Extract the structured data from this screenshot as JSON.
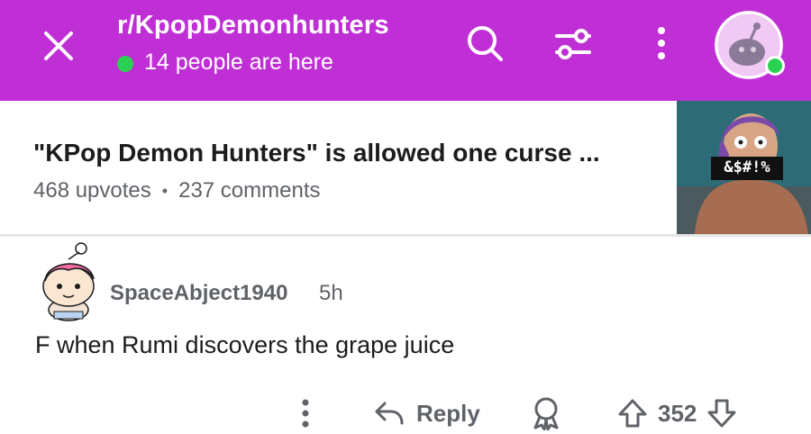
{
  "header": {
    "community": "r/KpopDemonhunters",
    "online_text": "14 people are here",
    "accent_color": "#c02fd6",
    "icons": [
      "close-icon",
      "search-icon",
      "filter-icon",
      "more-vertical-icon",
      "avatar"
    ]
  },
  "post": {
    "title": "\"KPop Demon Hunters\" is allowed one curse ...",
    "upvotes": "468 upvotes",
    "separator": "•",
    "comments": "237 comments",
    "thumbnail_caption": "&$#!%"
  },
  "comment": {
    "username": "SpaceAbject1940",
    "time": "5h",
    "body": "F when Rumi discovers the grape juice",
    "actions": {
      "reply_label": "Reply",
      "vote_count": "352"
    }
  }
}
